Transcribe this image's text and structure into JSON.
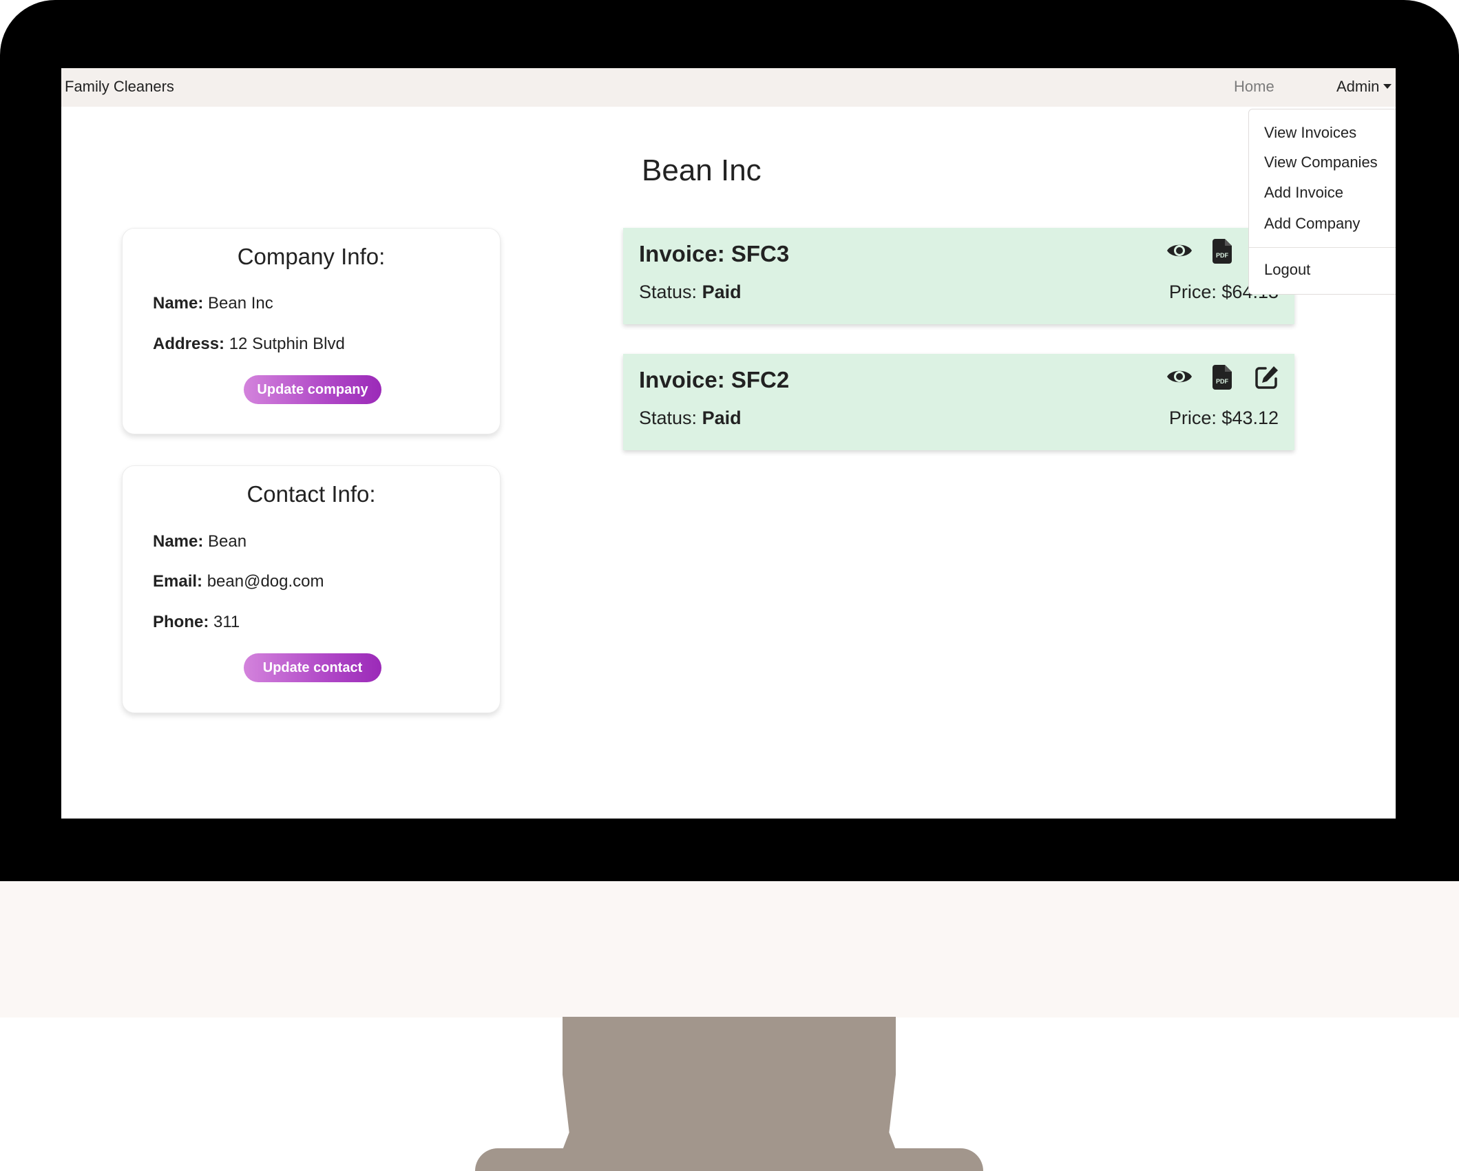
{
  "navbar": {
    "brand": "Family Cleaners",
    "home_label": "Home",
    "admin_label": "Admin"
  },
  "admin_menu": {
    "items": [
      {
        "label": "View Invoices"
      },
      {
        "label": "View Companies"
      },
      {
        "label": "Add Invoice"
      },
      {
        "label": "Add Company"
      },
      {
        "label": "Logout"
      }
    ]
  },
  "page": {
    "title": "Bean Inc"
  },
  "company_card": {
    "title": "Company Info:",
    "name_label": "Name:",
    "name_value": "Bean Inc",
    "address_label": "Address:",
    "address_value": "12 Sutphin Blvd",
    "button_label": "Update company"
  },
  "contact_card": {
    "title": "Contact Info:",
    "name_label": "Name:",
    "name_value": "Bean",
    "email_label": "Email:",
    "email_value": "bean@dog.com",
    "phone_label": "Phone:",
    "phone_value": "311",
    "button_label": "Update contact"
  },
  "invoices": [
    {
      "title": "Invoice: SFC3",
      "status_label": "Status:",
      "status_value": "Paid",
      "price": "Price: $64.13"
    },
    {
      "title": "Invoice: SFC2",
      "status_label": "Status:",
      "status_value": "Paid",
      "price": "Price: $43.12"
    }
  ],
  "icons": {
    "view": "eye-icon",
    "pdf": "file-pdf-icon",
    "edit": "edit-icon"
  },
  "colors": {
    "invoice_bg": "#dcf2e3",
    "button_gradient_start": "#d383dc",
    "button_gradient_end": "#9b2ab8",
    "navbar_bg": "#f4f0ed"
  }
}
